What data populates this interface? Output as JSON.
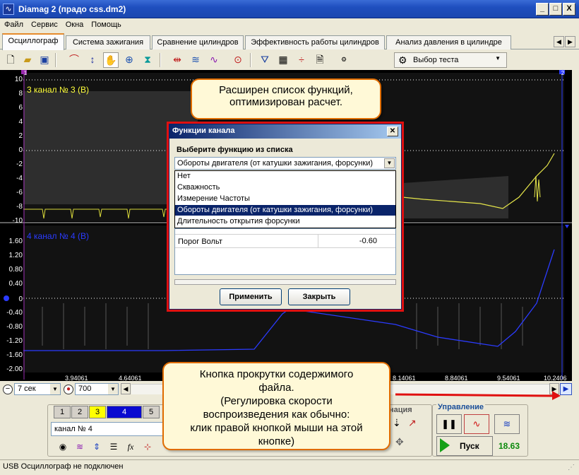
{
  "window": {
    "title": "Diamag 2 (прадо css.dm2)",
    "min_label": "_",
    "max_label": "□",
    "close_label": "X"
  },
  "menu": [
    "Файл",
    "Сервис",
    "Окна",
    "Помощь"
  ],
  "tabs": [
    "Осциллограф",
    "Система зажигания",
    "Сравнение цилиндров",
    "Эффективность работы цилиндров",
    "Анализ давления в цилиндре"
  ],
  "toolbar": {
    "test_select": "Выбор теста"
  },
  "scope": {
    "ch3_label": "3  канал № 3 (В)",
    "ch4_label": "4  канал № 4 (В)",
    "y3_ticks": [
      "10",
      "8",
      "6",
      "4",
      "2",
      "0",
      "-2",
      "-4",
      "-6",
      "-8",
      "-10"
    ],
    "y4_ticks": [
      "1.60",
      "1.20",
      "0.80",
      "0.40",
      "0",
      "-0.40",
      "-0.80",
      "-1.20",
      "-1.60",
      "-2.00"
    ],
    "x_ticks": [
      "3.94061",
      "4.64061",
      "8.14061",
      "8.84061",
      "9.54061",
      "10.2406"
    ],
    "marker_left": "1",
    "marker_right": "2"
  },
  "controls": {
    "time_window": "7 сек",
    "samples": "700",
    "channel_buttons": [
      "1",
      "2",
      "3",
      "4",
      "5"
    ],
    "channel_name": "канал № 4",
    "group_title": "Управление",
    "start_label": "Пуск",
    "time_value": "18.63",
    "partial_label": "нация"
  },
  "status": {
    "text": "USB Осциллограф не подключен"
  },
  "dialog": {
    "title": "Функции канала",
    "prompt": "Выберите функцию из списка",
    "selected": "Обороты двигателя (от катушки зажигания, форсунки)",
    "options": [
      "Нет",
      "Скважность",
      "Измерение Частоты",
      "Обороты двигателя (от катушки зажигания, форсунки)",
      "Длительность открытия форсунки"
    ],
    "param_name": "Порог Вольт",
    "param_value": "-0.60",
    "apply": "Применить",
    "close": "Закрыть"
  },
  "callouts": {
    "top_line1": "Расширен список функций,",
    "top_line2": "оптимизирован расчет.",
    "bottom_line1": "Кнопка прокрутки содержимого",
    "bottom_line2": "файла.",
    "bottom_line3": "(Регулировка скорости",
    "bottom_line4": "воспроизведения как обычно:",
    "bottom_line5": "клик правой кнопкой мыши на этой",
    "bottom_line6": "кнопке)"
  },
  "colors": {
    "ch3": "#ffff3c",
    "ch4": "#2b3bff",
    "highlight": "#e01010",
    "callout_bg": "#fff9d7",
    "callout_border": "#e06c00"
  }
}
